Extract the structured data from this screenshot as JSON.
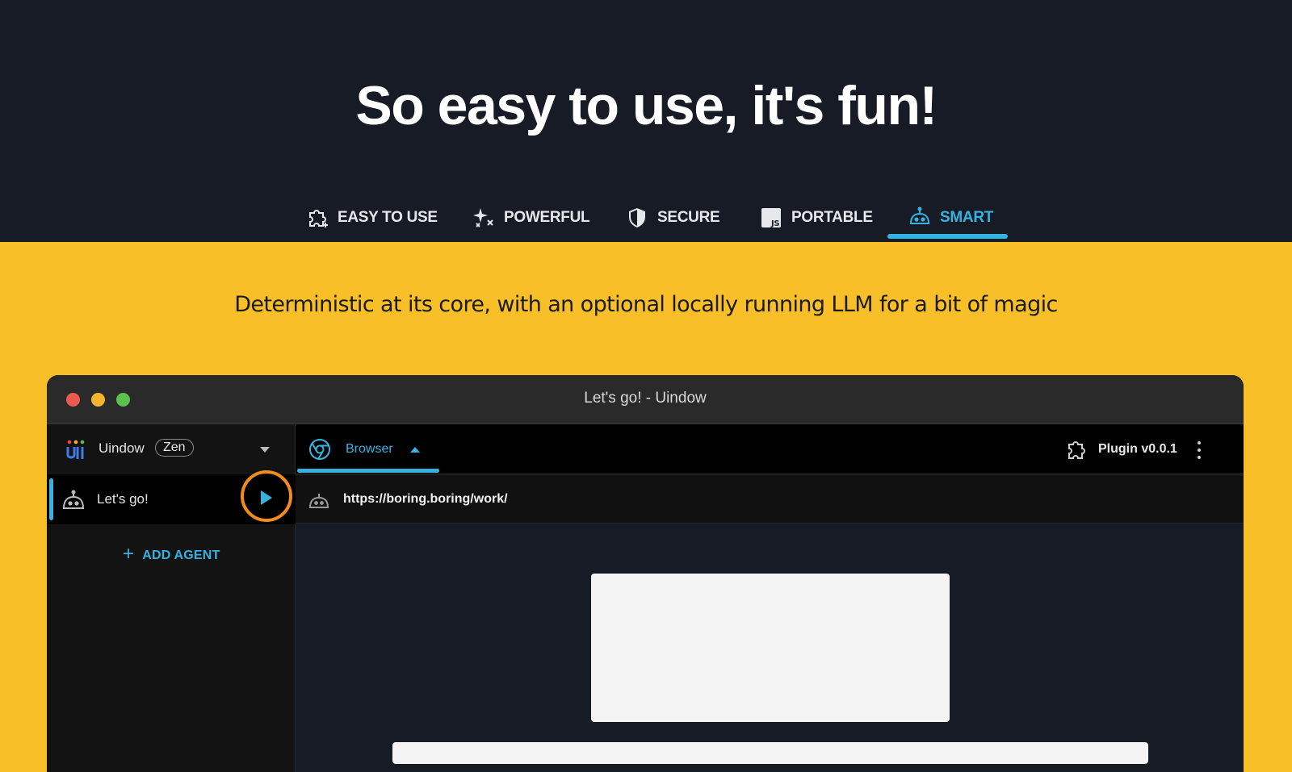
{
  "hero": {
    "title": "So easy to use, it's fun!",
    "tabs": [
      {
        "label": "EASY TO USE",
        "icon": "puzzle-icon"
      },
      {
        "label": "POWERFUL",
        "icon": "sparkles-icon"
      },
      {
        "label": "SECURE",
        "icon": "shield-icon"
      },
      {
        "label": "PORTABLE",
        "icon": "js-icon"
      },
      {
        "label": "SMART",
        "icon": "robot-icon",
        "active": true
      }
    ]
  },
  "tagline": "Deterministic at its core, with an optional locally running LLM for a bit of magic",
  "window": {
    "title": "Let's go! - Uindow",
    "sidebar": {
      "app_name": "Uindow",
      "badge": "Zen",
      "agents": [
        {
          "name": "Let's go!"
        }
      ],
      "add_agent": "ADD AGENT",
      "add_icon": "+"
    },
    "main": {
      "browser_tab": "Browser",
      "plugin": "Plugin v0.0.1",
      "url": "https://boring.boring/work/"
    }
  },
  "colors": {
    "accent": "#35b3e0",
    "highlight_ring": "#f08b1c",
    "yellow_bg": "#f8bf28",
    "dark_bg": "#161b26"
  }
}
